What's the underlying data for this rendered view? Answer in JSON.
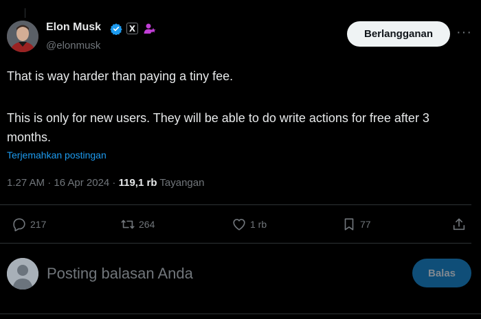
{
  "author": {
    "name": "Elon Musk",
    "handle": "@elonmusk",
    "x_badge": "X"
  },
  "header": {
    "subscribe_label": "Berlangganan",
    "more_label": "···"
  },
  "post": {
    "line1": "That is way harder than paying a tiny fee.",
    "line2": "This is only for new users. They will be able to do write actions for free after 3 months.",
    "translate_label": "Terjemahkan postingan",
    "timestamp": "1.27 AM · 16 Apr 2024 · ",
    "views_count": "119,1 rb",
    "views_label": " Tayangan"
  },
  "actions": {
    "replies": "217",
    "reposts": "264",
    "likes": "1 rb",
    "bookmarks": "77"
  },
  "reply_box": {
    "placeholder": "Posting balasan Anda",
    "button_label": "Balas"
  },
  "colors": {
    "background": "#000000",
    "text": "#e7e9ea",
    "muted": "#71767b",
    "accent": "#1d9bf0",
    "verified": "#1d9bf0",
    "affiliate": "#c13fd6"
  }
}
